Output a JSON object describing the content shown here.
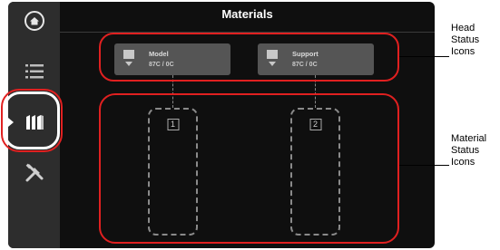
{
  "screen": {
    "title": "Materials"
  },
  "sidebar": {
    "items": [
      {
        "icon": "home-icon"
      },
      {
        "icon": "list-icon"
      },
      {
        "icon": "materials-icon",
        "active": true
      },
      {
        "icon": "tools-icon"
      }
    ]
  },
  "heads": [
    {
      "name": "Model",
      "temp": "87C / 0C",
      "icon": "print-head-icon"
    },
    {
      "name": "Support",
      "temp": "87C / 0C",
      "icon": "print-head-icon"
    }
  ],
  "slots": [
    {
      "number": "1"
    },
    {
      "number": "2"
    }
  ],
  "callouts": {
    "head_status": [
      "Head",
      "Status",
      "Icons"
    ],
    "material_status": [
      "Material",
      "Status",
      "Icons"
    ]
  },
  "colors": {
    "callout_ring": "#e02020",
    "screen_bg": "#0f0f0f",
    "sidebar_bg": "#2d2d2d",
    "card_bg": "#555555"
  }
}
